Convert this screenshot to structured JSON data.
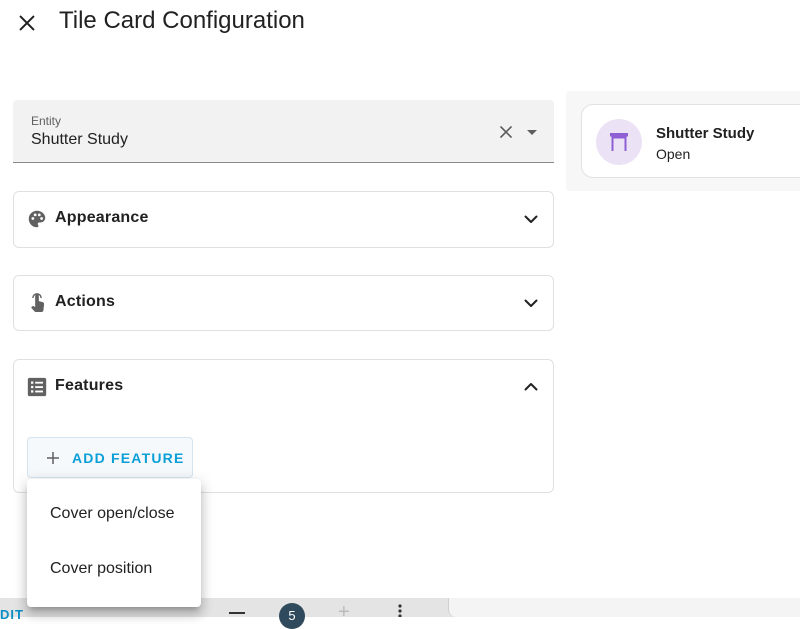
{
  "dialog": {
    "title": "Tile Card Configuration",
    "close_icon": "close-icon"
  },
  "entity_picker": {
    "label": "Entity",
    "value": "Shutter Study",
    "clear_icon": "close-icon",
    "dropdown_icon": "arrow-drop-down-icon"
  },
  "panels": [
    {
      "title": "Appearance",
      "icon": "palette-icon",
      "expanded": false
    },
    {
      "title": "Actions",
      "icon": "gesture-tap-icon",
      "expanded": false
    },
    {
      "title": "Features",
      "icon": "list-box-icon",
      "expanded": true
    }
  ],
  "features": {
    "add_button_label": "ADD FEATURE",
    "menu_items": [
      "Cover open/close",
      "Cover position"
    ]
  },
  "preview": {
    "entity_name": "Shutter Study",
    "state": "Open",
    "icon": "window-shutter-open-icon"
  },
  "background_toolbar": {
    "edit_label": "DIT",
    "count": "5"
  },
  "colors": {
    "accent": "#0b9fd8",
    "tile_icon": "#8e5ed4",
    "tile_icon_bg": "#ece2f6",
    "field_bg": "#f2f2f2"
  }
}
